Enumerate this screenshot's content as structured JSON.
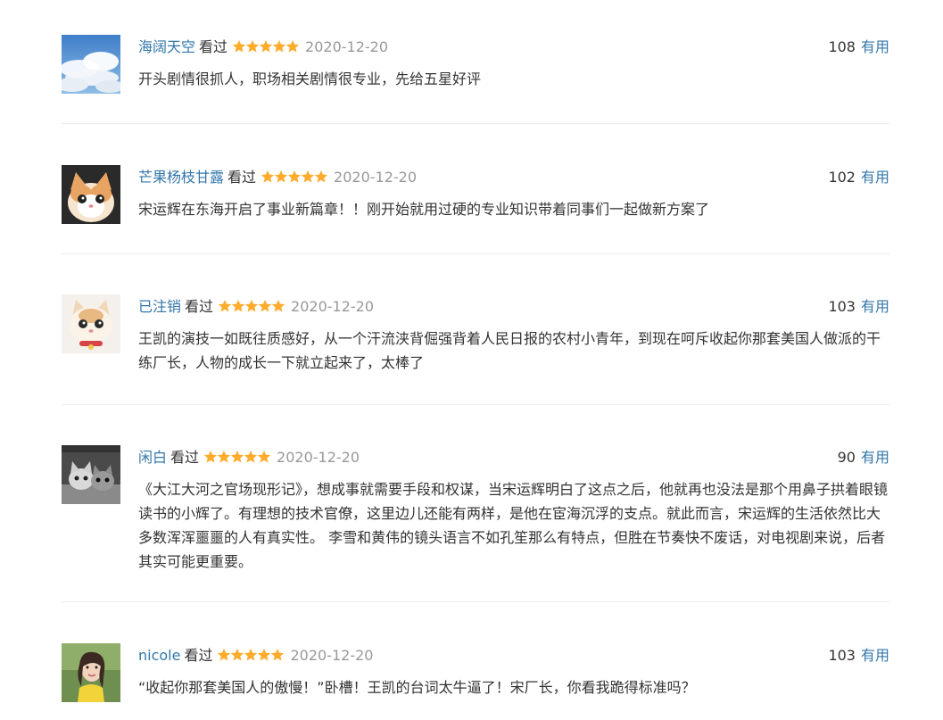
{
  "reviews": [
    {
      "username": "海阔天空",
      "status": "看过",
      "rating": 5,
      "date": "2020-12-20",
      "votes": "108",
      "vote_label": "有用",
      "comment": "开头剧情很抓人，职场相关剧情很专业，先给五星好评"
    },
    {
      "username": "芒果杨枝甘露",
      "status": "看过",
      "rating": 5,
      "date": "2020-12-20",
      "votes": "102",
      "vote_label": "有用",
      "comment": "宋运辉在东海开启了事业新篇章！！刚开始就用过硬的专业知识带着同事们一起做新方案了"
    },
    {
      "username": "已注销",
      "status": "看过",
      "rating": 5,
      "date": "2020-12-20",
      "votes": "103",
      "vote_label": "有用",
      "comment": "王凯的演技一如既往质感好，从一个汗流浃背倔强背着人民日报的农村小青年，到现在呵斥收起你那套美国人做派的干练厂长，人物的成长一下就立起来了，太棒了"
    },
    {
      "username": "闲白",
      "status": "看过",
      "rating": 5,
      "date": "2020-12-20",
      "votes": "90",
      "vote_label": "有用",
      "comment": "《大江大河之官场现形记》，想成事就需要手段和权谋，当宋运辉明白了这点之后，他就再也没法是那个用鼻子拱着眼镜读书的小辉了。有理想的技术官僚，这里边儿还能有两样，是他在宦海沉浮的支点。就此而言，宋运辉的生活依然比大多数浑浑噩噩的人有真实性。 李雪和黄伟的镜头语言不如孔笙那么有特点，但胜在节奏快不废话，对电视剧来说，后者其实可能更重要。"
    },
    {
      "username": "nicole",
      "status": "看过",
      "rating": 5,
      "date": "2020-12-20",
      "votes": "103",
      "vote_label": "有用",
      "comment": "“收起你那套美国人的傲慢！”卧槽！王凯的台词太牛逼了！宋厂长，你看我跪得标准吗？"
    }
  ],
  "colors": {
    "link": "#3377aa",
    "star": "#ffac2d",
    "date": "#999999",
    "text": "#333333",
    "divider": "#ececec"
  },
  "icons": {
    "avatar_1": "sky-clouds-avatar",
    "avatar_2": "cat-avatar",
    "avatar_3": "cat-avatar",
    "avatar_4": "cats-grayscale-avatar",
    "avatar_5": "woman-portrait-avatar",
    "rating": "star-icon"
  }
}
